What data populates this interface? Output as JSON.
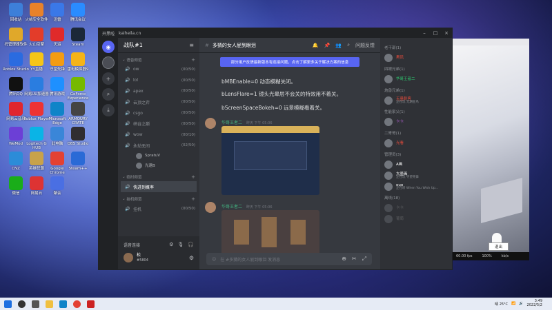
{
  "desktop_icons": [
    {
      "label": "回收站",
      "color": "#3d7fd9"
    },
    {
      "label": "火绒安全软件",
      "color": "#e8822a"
    },
    {
      "label": "迅雷",
      "color": "#3a78e8"
    },
    {
      "label": "腾讯会议",
      "color": "#2a8cff"
    },
    {
      "label": "托管理器软件",
      "color": "#e0a82a"
    },
    {
      "label": "火山引擎",
      "color": "#e33c2a"
    },
    {
      "label": "天运",
      "color": "#e02a2a"
    },
    {
      "label": "Steam",
      "color": "#1b2838"
    },
    {
      "label": "Roblox Studio",
      "color": "#2a6be0"
    },
    {
      "label": "YY直播",
      "color": "#f5c518"
    },
    {
      "label": "守望先锋",
      "color": "#f39c12"
    },
    {
      "label": "雷电模拟器9",
      "color": "#f5b418"
    },
    {
      "label": "腾讯QQ",
      "color": "#111"
    },
    {
      "label": "网易UU加速器",
      "color": "#2a7de0"
    },
    {
      "label": "腾讯游戏",
      "color": "#1e90ff"
    },
    {
      "label": "GeForce Experience",
      "color": "#76b900"
    },
    {
      "label": "网易云音乐",
      "color": "#e0262e"
    },
    {
      "label": "Roblox Player",
      "color": "#e33"
    },
    {
      "label": "Microsoft Edge",
      "color": "#0f84c8"
    },
    {
      "label": "ARMOURY CRATE",
      "color": "#444"
    },
    {
      "label": "WeMod",
      "color": "#6c3fd6"
    },
    {
      "label": "Logitech G HUB",
      "color": "#0ab4e6"
    },
    {
      "label": "此电脑",
      "color": "#3a86d8"
    },
    {
      "label": "OBS Studio",
      "color": "#302e31"
    },
    {
      "label": "CNZ",
      "color": "#2c8cd8"
    },
    {
      "label": "英雄联盟",
      "color": "#c8a24a"
    },
    {
      "label": "Google Chrome",
      "color": "#e34133"
    },
    {
      "label": "Steam++",
      "color": "#2a6ad6"
    },
    {
      "label": "微信",
      "color": "#1aad19"
    },
    {
      "label": "网易云",
      "color": "#d33"
    },
    {
      "label": "聚会",
      "color": "#4a6fe3"
    }
  ],
  "window": {
    "app_name": "开黑啦",
    "domain": "kaiheila.cn",
    "controls": [
      "–",
      "□",
      "×"
    ]
  },
  "server": {
    "name": "战队#1",
    "categories": [
      {
        "label": "语音频道",
        "channels": [
          {
            "name": "ow",
            "count": "(00/50)"
          },
          {
            "name": "lol",
            "count": "(00/50)"
          },
          {
            "name": "apex",
            "count": "(00/50)"
          },
          {
            "name": "云顶之弈",
            "count": "(00/50)"
          },
          {
            "name": "csgo",
            "count": "(00/50)"
          },
          {
            "name": "峡谷之巅",
            "count": "(00/50)"
          },
          {
            "name": "wow",
            "count": "(00/10)"
          },
          {
            "name": "永劫无间",
            "count": "(02/50)"
          }
        ]
      },
      {
        "label": "临时频道",
        "channels": [
          {
            "name": "快进到概率",
            "count": ""
          }
        ]
      },
      {
        "label": "挂机频道",
        "channels": [
          {
            "name": "挂机",
            "count": "(00/50)"
          }
        ]
      }
    ],
    "voice_members": [
      {
        "name": "SpratuV"
      },
      {
        "name": "光速B"
      }
    ]
  },
  "voice_panel": {
    "status": "语音连接",
    "username": "松",
    "tag": "#5804"
  },
  "chat": {
    "channel": "多猜的女人屁到眼泪",
    "header_badge": "问题反馈",
    "notice": "部分用户反馈最新版本有连接问题，点击了解更多关于解决方案的信息",
    "lines": [
      "bMBEnable=0 动态模糊关闭。",
      "bLensFlare=1 镜头光晕层不会关的特效用不着关。",
      "bScreenSpaceBokeh=0 远景模糊看着关。"
    ],
    "messages": [
      {
        "author": "华哥王者二",
        "time": "昨天 下午 05:06"
      },
      {
        "author": "华哥王者二",
        "time": "昨天 下午 05:06"
      }
    ],
    "composer_placeholder": "在 #多猜的女人屁到眼泪 发消息"
  },
  "members": {
    "groups": [
      {
        "label": "老干部(1)",
        "items": [
          {
            "name": "黑凤",
            "sub": "",
            "color": "#e74c3c"
          }
        ]
      },
      {
        "label": "四眼兄弟(1)",
        "items": [
          {
            "name": "华哥王者二",
            "sub": "",
            "color": "#2ecc71"
          }
        ]
      },
      {
        "label": "炮兽兄弟(1)",
        "items": [
          {
            "name": "无量刺客",
            "sub": "正在玩 无期狂鸟",
            "color": "#e74c3c"
          }
        ]
      },
      {
        "label": "性能家父(1)",
        "items": [
          {
            "name": "卡卡",
            "sub": "",
            "color": "#9b59b6"
          }
        ]
      },
      {
        "label": "二哥哥(1)",
        "items": [
          {
            "name": "光看",
            "sub": "",
            "color": "#e74c3c"
          }
        ]
      },
      {
        "label": "管理员(3)",
        "items": [
          {
            "name": "A画",
            "sub": "",
            "color": "#fff"
          },
          {
            "name": "大墨画",
            "sub": "正在玩 守望先锋",
            "color": "#fff"
          },
          {
            "name": "ouo",
            "sub": "正在听 When You Wish Up...",
            "color": "#fff"
          }
        ]
      },
      {
        "label": "离线(18)",
        "items": [
          {
            "name": "卡卡",
            "sub": "",
            "color": "#999"
          },
          {
            "name": "葡萄",
            "sub": "",
            "color": "#999"
          }
        ]
      }
    ]
  },
  "side_window": {
    "stats": [
      "60.00 fps",
      "100%",
      "kb/s"
    ],
    "button": "退出"
  },
  "taskbar": {
    "time": "3:49",
    "date": "2022/5/2",
    "weather": "晴 25°C"
  }
}
